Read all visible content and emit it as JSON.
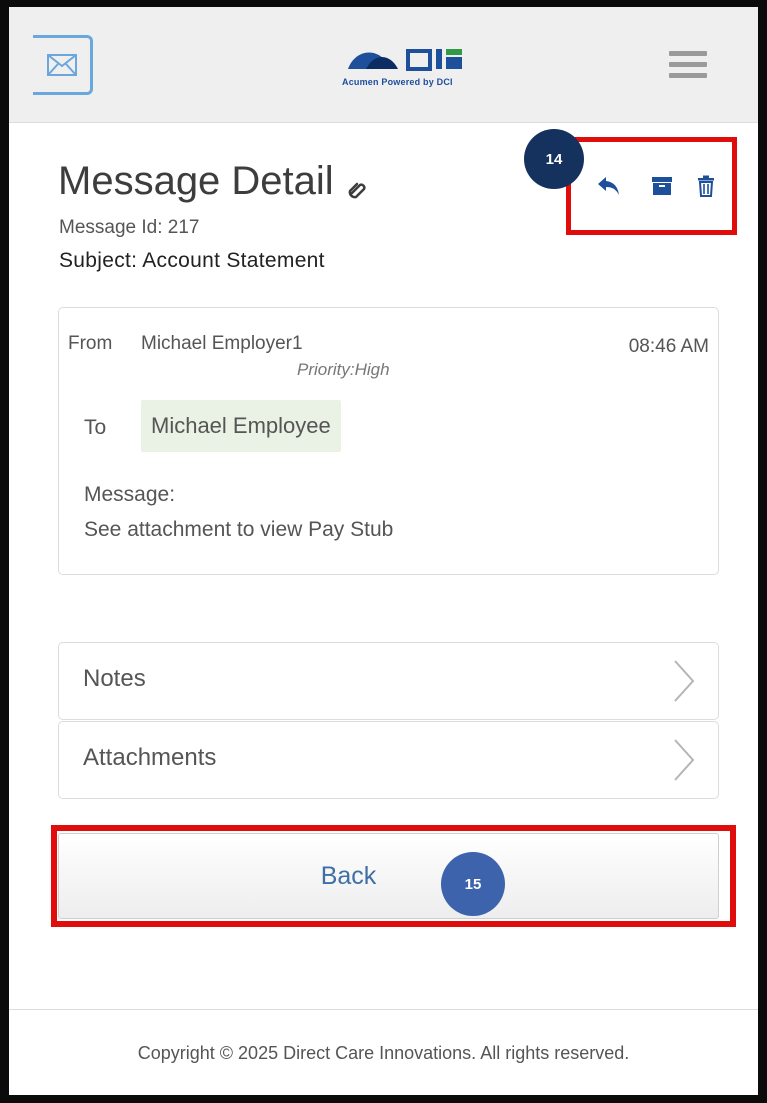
{
  "header": {
    "logo_text": "Acumen Powered by DCI"
  },
  "page": {
    "title": "Message Detail",
    "message_id": "Message Id: 217",
    "subject": "Subject: Account Statement"
  },
  "annotations": {
    "step_a": "14",
    "step_b": "15"
  },
  "message": {
    "from_label": "From",
    "from_name": "Michael Employer1",
    "priority": "Priority:High",
    "time": "08:46 AM",
    "to_label": "To",
    "to_name": "Michael Employee",
    "message_label": "Message:",
    "message_text": "See attachment to view Pay Stub"
  },
  "sections": {
    "notes": "Notes",
    "attachments": "Attachments"
  },
  "buttons": {
    "back": "Back"
  },
  "footer": {
    "copyright": "Copyright © 2025 Direct Care Innovations. All rights reserved."
  },
  "icons": {
    "mail": "envelope-icon",
    "menu": "hamburger-menu-icon",
    "attachment": "paperclip-icon",
    "reply": "reply-icon",
    "archive": "archive-icon",
    "delete": "trash-icon",
    "chevron": "chevron-right-icon"
  },
  "colors": {
    "highlight": "#e00d0d",
    "accent_blue": "#1e4f9a",
    "badge_dark": "#15315e",
    "badge_blue": "#3d63ad"
  }
}
